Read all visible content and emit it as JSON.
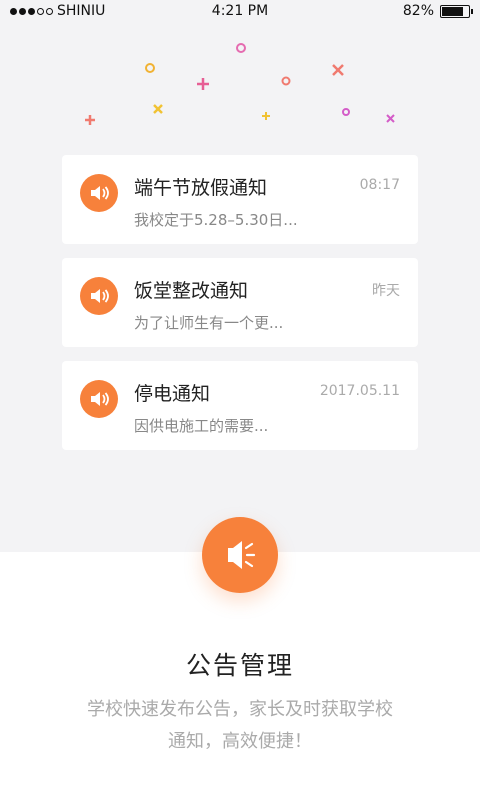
{
  "status": {
    "carrier": "SHINIU",
    "time": "4:21 PM",
    "battery": "82%",
    "battery_level": 0.82
  },
  "confetti_colors": {
    "pink": "#e75f95",
    "orange": "#f29a4f",
    "yellow": "#f1c233",
    "magenta": "#d45cc8",
    "red": "#f07a6f"
  },
  "notices": [
    {
      "title": "端午节放假通知",
      "time": "08:17",
      "preview": "我校定于5.28–5.30日..."
    },
    {
      "title": "饭堂整改通知",
      "time": "昨天",
      "preview": "为了让师生有一个更..."
    },
    {
      "title": "停电通知",
      "time": "2017.05.11",
      "preview": "因供电施工的需要..."
    }
  ],
  "feature": {
    "title": "公告管理",
    "desc_line1": "学校快速发布公告，家长及时获取学校",
    "desc_line2": "通知，高效便捷！"
  },
  "accent_color": "#f7813b"
}
